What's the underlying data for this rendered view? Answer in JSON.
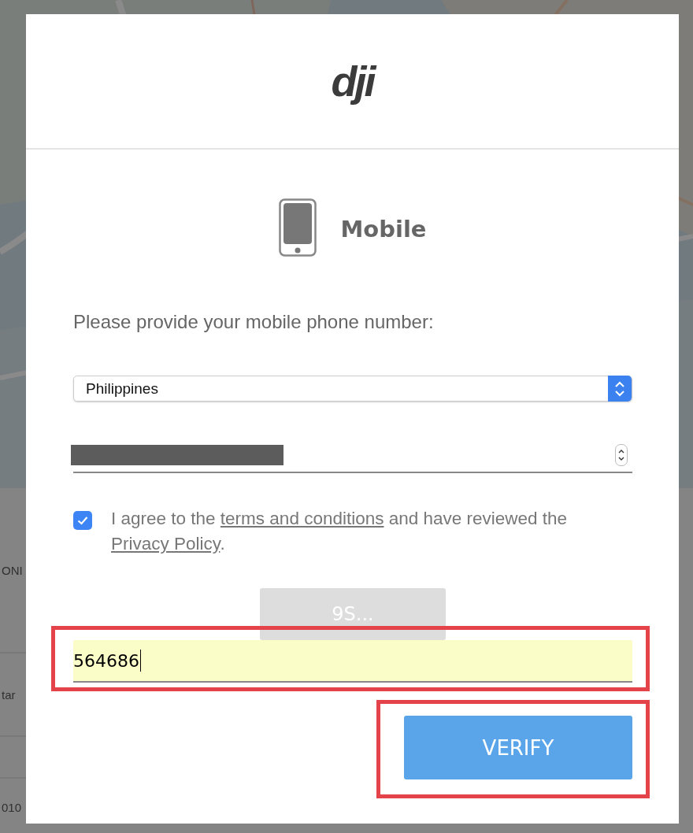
{
  "background": {
    "fragments": [
      "ONI",
      "tar",
      "010"
    ]
  },
  "dialog": {
    "logo": "dji",
    "method": {
      "title": "Mobile"
    },
    "prompt": "Please provide your mobile phone number:",
    "country": {
      "value": "Philippines"
    },
    "phone": {
      "redacted": true
    },
    "agreement": {
      "checked": true,
      "before": "I agree to the ",
      "terms_link": "terms and conditions",
      "middle": " and have reviewed the ",
      "privacy_link": "Privacy Policy",
      "after": "."
    },
    "resend_button": {
      "label": "9S...",
      "disabled": true
    },
    "code_field": {
      "value": "564686",
      "highlighted": true
    },
    "verify_button": {
      "label": "VERIFY",
      "highlighted": true
    }
  }
}
